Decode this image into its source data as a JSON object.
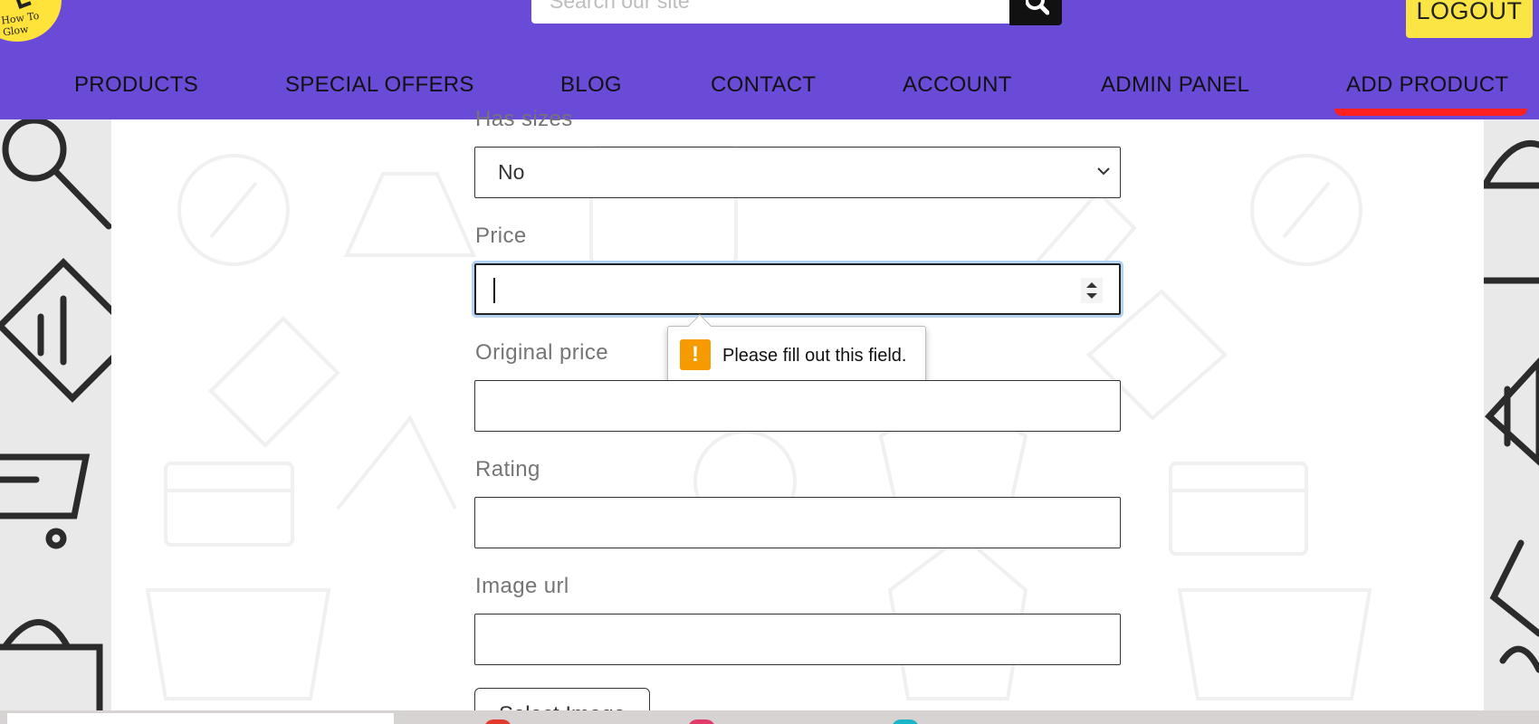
{
  "header": {
    "logo_text": "How To Glow",
    "search_placeholder": "Search our site",
    "logout_label": "LOGOUT",
    "nav": [
      {
        "label": "PRODUCTS"
      },
      {
        "label": "SPECIAL OFFERS"
      },
      {
        "label": "BLOG"
      },
      {
        "label": "CONTACT"
      },
      {
        "label": "ACCOUNT"
      },
      {
        "label": "ADMIN PANEL"
      },
      {
        "label": "ADD PRODUCT"
      }
    ],
    "active_nav": "ADD PRODUCT",
    "brand_color": "#6a4bd8",
    "accent_color": "#fbe545",
    "active_underline_color": "#ff2020"
  },
  "form": {
    "has_sizes": {
      "label": "Has sizes",
      "value": "No"
    },
    "price": {
      "label": "Price",
      "value": ""
    },
    "validation": {
      "message": "Please fill out this field."
    },
    "original_price": {
      "label": "Original price",
      "value": ""
    },
    "rating": {
      "label": "Rating",
      "value": ""
    },
    "image_url": {
      "label": "Image url",
      "value": ""
    },
    "select_image_label": "Select Image"
  }
}
